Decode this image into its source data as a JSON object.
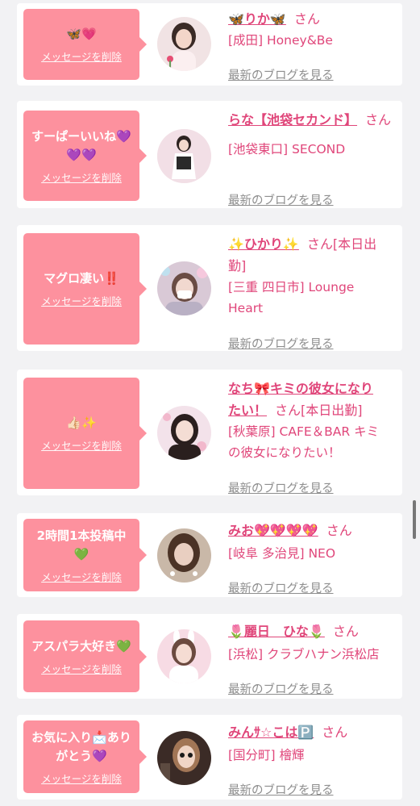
{
  "cards": [
    {
      "message": "🦋💗",
      "delete_label": "メッセージを削除",
      "name": "🦋りか🦋",
      "san": "さん",
      "shop_lines": [
        "[成田] Honey&Be"
      ],
      "blog_label": "最新のブログを見る"
    },
    {
      "message": "すーぱーいいね💜\n💜💜",
      "delete_label": "メッセージを削除",
      "name": "らな【池袋セカンド】",
      "san": "さん",
      "shop_lines": [
        "[池袋東口] SECOND"
      ],
      "blog_label": "最新のブログを見る"
    },
    {
      "message": "マグロ凄い‼️",
      "delete_label": "メッセージを削除",
      "name": "✨ひかり✨",
      "san": "さん[本日出",
      "name_extra": "勤]",
      "shop_lines": [
        "[三重 四日市] Lounge",
        "Heart"
      ],
      "blog_label": "最新のブログを見る"
    },
    {
      "message": "👍🏻✨",
      "delete_label": "メッセージを削除",
      "name": "なち🎀キミの彼女になり",
      "name_cont": "たい！",
      "san": "さん[本日出勤]",
      "shop_lines": [
        "[秋葉原] CAFE＆BAR キミ",
        "の彼女になりたい！"
      ],
      "blog_label": "最新のブログを見る"
    },
    {
      "message": "2時間1本投稿中\n💚",
      "delete_label": "メッセージを削除",
      "name": "みお💖💖💖💖",
      "san": "さん",
      "shop_lines": [
        "[岐阜 多治見] NEO"
      ],
      "blog_label": "最新のブログを見る"
    },
    {
      "message": "アスパラ大好き💚",
      "delete_label": "メッセージを削除",
      "name": "🌷麗日　ひな🌷",
      "san": "さん",
      "shop_lines": [
        "[浜松] クラブハナン浜松店"
      ],
      "blog_label": "最新のブログを見る"
    },
    {
      "message": "お気に入り📩あり\nがとう💜",
      "delete_label": "メッセージを削除",
      "name": "みんｻ☆こは🅿️",
      "san": "さん",
      "shop_lines": [
        "[国分町] 檜輝"
      ],
      "blog_label": "最新のブログを見る"
    }
  ]
}
